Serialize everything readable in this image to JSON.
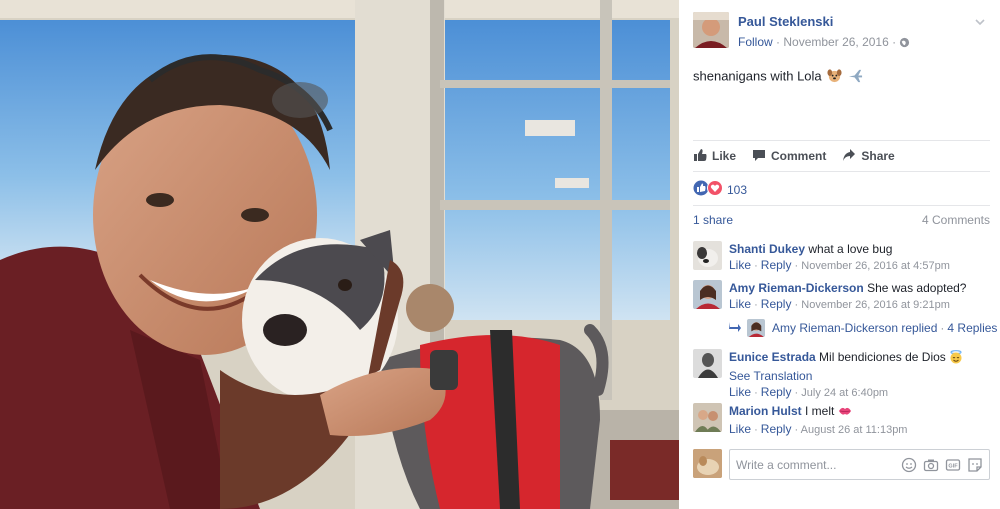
{
  "post": {
    "author": "Paul Steklenski",
    "follow_label": "Follow",
    "date": "November 26, 2016",
    "separator": "·",
    "caption": "shenanigans with Lola",
    "caption_emojis": [
      "dog-face-icon",
      "airplane-icon"
    ]
  },
  "actions": {
    "like": "Like",
    "comment": "Comment",
    "share": "Share"
  },
  "reactions": {
    "count": "103",
    "types": [
      "like-reaction-icon",
      "love-reaction-icon"
    ]
  },
  "summary": {
    "shares": "1 share",
    "comments": "4 Comments"
  },
  "comments": [
    {
      "name": "Shanti Dukey",
      "text": "what a love bug",
      "like": "Like",
      "reply": "Reply",
      "time": "November 26, 2016 at 4:57pm"
    },
    {
      "name": "Amy Rieman-Dickerson",
      "text": "She was adopted?",
      "like": "Like",
      "reply": "Reply",
      "time": "November 26, 2016 at 9:21pm"
    },
    {
      "name": "Eunice Estrada",
      "text": "Mil bendiciones de Dios",
      "translation": "See Translation",
      "like": "Like",
      "reply": "Reply",
      "time": "July 24 at 6:40pm"
    },
    {
      "name": "Marion Hulst",
      "text": "I melt",
      "like": "Like",
      "reply": "Reply",
      "time": "August 26 at 11:13pm"
    }
  ],
  "reply_thread": {
    "name": "Amy Rieman-Dickerson",
    "action": "replied",
    "count": "4 Replies"
  },
  "composer": {
    "placeholder": "Write a comment..."
  },
  "colors": {
    "link": "#365899",
    "meta": "#90949c",
    "text": "#1d2129",
    "like_blue": "#4267b2",
    "love_red": "#f25268"
  }
}
